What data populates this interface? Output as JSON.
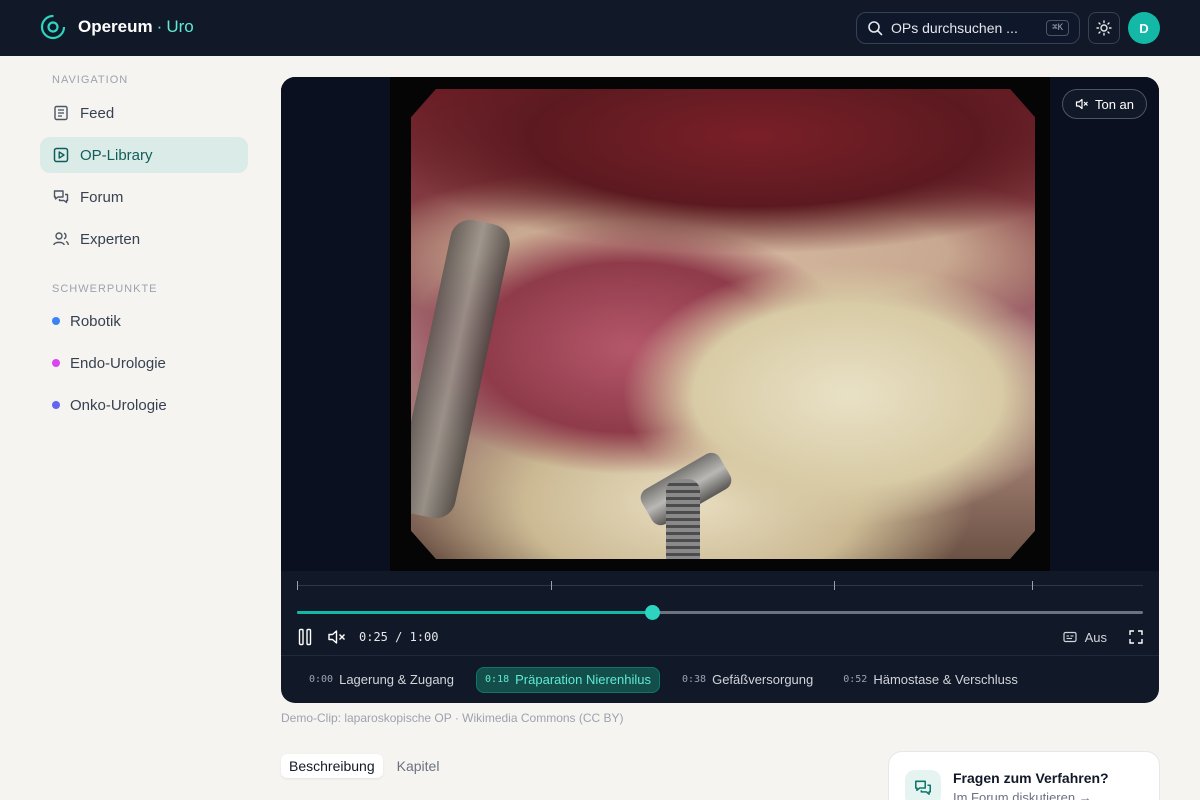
{
  "header": {
    "brand_name": "Opereum",
    "brand_sep": "·",
    "brand_sub": "Uro",
    "search_placeholder": "OPs durchsuchen ...",
    "search_shortcut": "⌘K",
    "avatar_initial": "D"
  },
  "sidebar": {
    "nav_heading": "NAVIGATION",
    "nav_items": [
      {
        "label": "Feed"
      },
      {
        "label": "OP-Library"
      },
      {
        "label": "Forum"
      },
      {
        "label": "Experten"
      }
    ],
    "focus_heading": "SCHWERPUNKTE",
    "focus_items": [
      {
        "label": "Robotik",
        "color": "#3b82f6"
      },
      {
        "label": "Endo-Urologie",
        "color": "#d946ef"
      },
      {
        "label": "Onko-Urologie",
        "color": "#6366f1"
      }
    ]
  },
  "player": {
    "sound_label": "Ton an",
    "time_current": "0:25",
    "time_separator": "/",
    "time_total": "1:00",
    "progress_fraction": 0.42,
    "captions_label": "Aus",
    "chapters": [
      {
        "time": "0:00",
        "label": "Lagerung & Zugang"
      },
      {
        "time": "0:18",
        "label": "Präparation Nierenhilus"
      },
      {
        "time": "0:38",
        "label": "Gefäßversorgung"
      },
      {
        "time": "0:52",
        "label": "Hämostase & Verschluss"
      }
    ]
  },
  "caption": "Demo-Clip: laparoskopische OP · Wikimedia Commons (CC BY)",
  "tabs": {
    "description": "Beschreibung",
    "chapters": "Kapitel"
  },
  "forum_card": {
    "title": "Fragen zum Verfahren?",
    "link": "Im Forum diskutieren →"
  },
  "colors": {
    "accent": "#14b8a6",
    "header_bg": "#111827",
    "page_bg": "#f6f4f0"
  }
}
